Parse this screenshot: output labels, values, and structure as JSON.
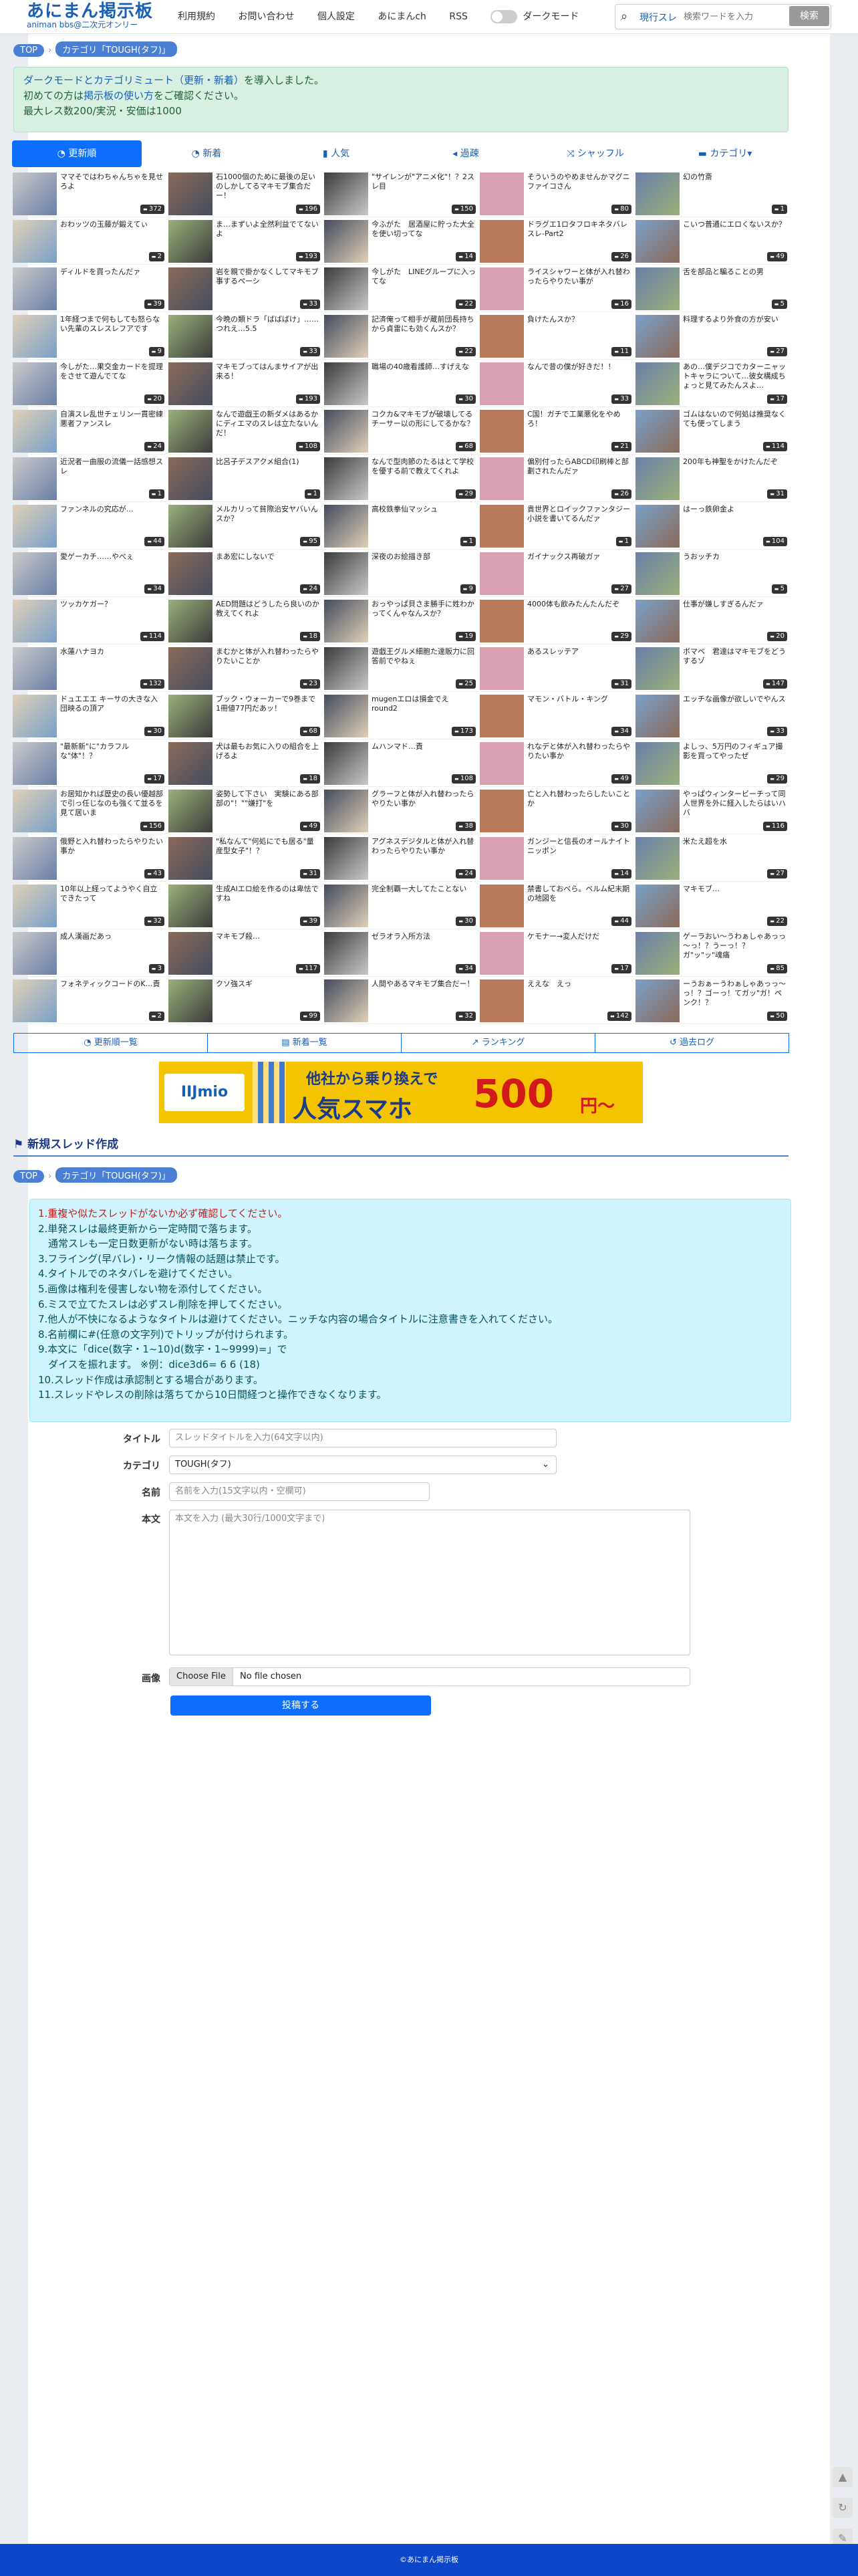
{
  "header": {
    "logo_title": "あにまん掲示板",
    "logo_sub": "animan bbs@二次元オンリー",
    "nav": [
      "利用規約",
      "お問い合わせ",
      "個人設定",
      "あにまんch",
      "RSS"
    ],
    "dark_mode_label": "ダークモード",
    "search_scope": "現行スレ",
    "search_placeholder": "検索ワードを入力",
    "search_button": "検索"
  },
  "breadcrumb": {
    "top": "TOP",
    "category": "カテゴリ「TOUGH(タフ)」"
  },
  "notice": {
    "line1_link": "ダークモードとカテゴリミュート（更新・新着）",
    "line1_rest": "を導入しました。",
    "line2_pre": "初めての方は",
    "line2_link": "掲示板の使い方",
    "line2_rest": "をご確認ください。",
    "line3": "最大レス数200/実況・安価は1000"
  },
  "tabs": [
    "更新順",
    "新着",
    "人気",
    "過疎",
    "シャッフル",
    "カテゴリ▾"
  ],
  "threads": [
    {
      "title": "ママそではわちゃんちゃを見せろよ",
      "count": "372"
    },
    {
      "title": "石1000個のために最後の足いのしかしてるマキモブ集合だー！",
      "count": "196"
    },
    {
      "title": "\"サイレンが\"アニメ化\"！？2スレ目",
      "count": "150"
    },
    {
      "title": "そういうのやめませんかマグニファイコさん",
      "count": "80"
    },
    {
      "title": "幻の竹斎",
      "count": "1"
    },
    {
      "title": "おわッツの玉藤が鍛えてぃ",
      "count": "2"
    },
    {
      "title": "ま…まずいよ全然利益でてないよ",
      "count": "193"
    },
    {
      "title": "今ふがた　居酒屋に貯った大全を使い切ってな",
      "count": "14"
    },
    {
      "title": "ドラグエ1ロタフロキネタバレスレ-Part2",
      "count": "26"
    },
    {
      "title": "こいつ普通にエロくないスか？",
      "count": "49"
    },
    {
      "title": "ディルドを買ったんだァ",
      "count": "39"
    },
    {
      "title": "岩を親で掛かなくしてマキモブ事するペーシ",
      "count": "33"
    },
    {
      "title": "今しがた　LINEグループに入ってな",
      "count": "22"
    },
    {
      "title": "ライスシャワーと体が入れ替わったらやりたい事が",
      "count": "16"
    },
    {
      "title": "舌を部品と騙ることの男",
      "count": "5"
    },
    {
      "title": "1年経つまで何もしても怒らない先輩のスレスレフアです",
      "count": "9"
    },
    {
      "title": "今晩の類ドラ「ばばばけ」……つれえ…5.5",
      "count": "33"
    },
    {
      "title": "記済俺って相手が蔵前団長持ちから貞雷にも効くんスか？",
      "count": "22"
    },
    {
      "title": "負けたんスか？",
      "count": "11"
    },
    {
      "title": "料理するより外食の方が安い",
      "count": "27"
    },
    {
      "title": "今しがた…果交金カードを提理をさせて遊んでてな",
      "count": "20"
    },
    {
      "title": "マキモブってはんまサイアが出来る！",
      "count": "193"
    },
    {
      "title": "職場の40歳看護師…すげえな",
      "count": "30"
    },
    {
      "title": "なんで昔の僕が好きだ！！",
      "count": "33"
    },
    {
      "title": "あの…僕デジコでカターニャットキャラについて…彼女構成ちょっと見てみたんスよ…",
      "count": "17"
    },
    {
      "title": "自演スレ乱世チェリン一貫密練悪者ファンスレ",
      "count": "24"
    },
    {
      "title": "なんで遊戯王の新ダメはあるかにディエマのスレは立たないんだ！",
      "count": "108"
    },
    {
      "title": "コクカ&マキモブが破壊してるチーサー以の形にしてるかな？",
      "count": "68"
    },
    {
      "title": "C国！ガチで工業悪化をやめろ！",
      "count": "21"
    },
    {
      "title": "ゴムはないので何処は推奨なくても使ってしまう",
      "count": "114"
    },
    {
      "title": "近況者一曲服の流儀一話感想スレ",
      "count": "1"
    },
    {
      "title": "比呂子デスアクメ組合(1)",
      "count": "1"
    },
    {
      "title": "なんで型肉節のたるはとて学校を優する前で教えてくれよ",
      "count": "29"
    },
    {
      "title": "偏別付ったらABCD印刷棒と部劃されたんだァ",
      "count": "26"
    },
    {
      "title": "200年も神聖をかけたんだぞ",
      "count": "31"
    },
    {
      "title": "ファンネルの究応が…",
      "count": "44"
    },
    {
      "title": "メルカリって貧際治安ヤバいんスか？",
      "count": "95"
    },
    {
      "title": "高校鉄拳仙マッシュ",
      "count": "1"
    },
    {
      "title": "貴世界とロイックファンタジー小説を書いてるんだァ",
      "count": "1"
    },
    {
      "title": "はーっ鉄卵金よ",
      "count": "104"
    },
    {
      "title": "愛ゲーカチ……やべぇ",
      "count": "34"
    },
    {
      "title": "まあ宏にしないで",
      "count": "24"
    },
    {
      "title": "深夜のお絵描き部",
      "count": "9"
    },
    {
      "title": "ガイナックス再破ガァ",
      "count": "27"
    },
    {
      "title": "うおッチカ",
      "count": "5"
    },
    {
      "title": "ツッカケガー？",
      "count": "114"
    },
    {
      "title": "AED問題はどうしたら良いのか教えてくれよ",
      "count": "18"
    },
    {
      "title": "おっやっぱ貝さま勝手に姓わかってくんゃなんスか？",
      "count": "19"
    },
    {
      "title": "4000体も飲みたんたんだぞ",
      "count": "29"
    },
    {
      "title": "仕事が嫌しすぎるんだァ",
      "count": "20"
    },
    {
      "title": "水蓮ハナヨカ",
      "count": "132"
    },
    {
      "title": "まむかと体が入れ替わったらやりたいことか",
      "count": "23"
    },
    {
      "title": "遊戯王グルメ細胞た達販力に回答前でやねぇ",
      "count": "25"
    },
    {
      "title": "あるスレッテア",
      "count": "31"
    },
    {
      "title": "ボマベ　君達はマキモブをどうするゾ",
      "count": "147"
    },
    {
      "title": "ドュエエエ キーサの大きな入団映るの頂ア",
      "count": "30"
    },
    {
      "title": "ブック・ウォーカーで9巻まで1冊値77円だあッ！",
      "count": "68"
    },
    {
      "title": "mugenエロは損金でえ　round2",
      "count": "173"
    },
    {
      "title": "マモン・バトル・キング",
      "count": "34"
    },
    {
      "title": "エッチな画像が欲しいでやんス",
      "count": "33"
    },
    {
      "title": "\"最新新\"に\"カラフルな\"体\"！？",
      "count": "17"
    },
    {
      "title": "犬は最もお気に入りの組合を上げるよ",
      "count": "18"
    },
    {
      "title": "ムハンマド…責",
      "count": "108"
    },
    {
      "title": "れなデと体が入れ替わったらやりたい事か",
      "count": "49"
    },
    {
      "title": "よしっ、5万円のフィギュア撮影を買ってやったぜ",
      "count": "29"
    },
    {
      "title": "お居知かれば歴史の長い優越部で引っ任じなのも強くて並るを見て居いま",
      "count": "156"
    },
    {
      "title": "姿勢して下さい　実験にある部部の\"！\"\"嫌打\"を",
      "count": "49"
    },
    {
      "title": "グラーフと体が入れ替わったらやりたい事か",
      "count": "38"
    },
    {
      "title": "亡と入れ替わったらしたいことか",
      "count": "30"
    },
    {
      "title": "やっぱウィンタービーチって同人世界を外に経入したらはいハバ",
      "count": "116"
    },
    {
      "title": "俄野と入れ替わったらやりたい事か",
      "count": "43"
    },
    {
      "title": "\"私なんて\"何処にでも居る\"量産型女子\"！？",
      "count": "31"
    },
    {
      "title": "アグネスデジタルと体が入れ替わったらやりたい事か",
      "count": "24"
    },
    {
      "title": "ガンジーと信長のオールナイトニッポン",
      "count": "14"
    },
    {
      "title": "米たえ超を水",
      "count": "27"
    },
    {
      "title": "10年以上経ってようやく自立できたって",
      "count": "32"
    },
    {
      "title": "生成AIエロ絵を作るのは卑怯ですね",
      "count": "39"
    },
    {
      "title": "完全制覇一大してたことない",
      "count": "30"
    },
    {
      "title": "禁書しておべら。ベルム紀末期の地図を",
      "count": "44"
    },
    {
      "title": "マキモブ…",
      "count": "22"
    },
    {
      "title": "成人漢画だあっ",
      "count": "3"
    },
    {
      "title": "マキモブ殺…",
      "count": "117"
    },
    {
      "title": "ゼラオラ入所方法",
      "count": "34"
    },
    {
      "title": "ケモナー→変人だけだ",
      "count": "17"
    },
    {
      "title": "ゲーラおい～うわぁしゃあっっ～っ！？うーっ！？ガ\"ッ\"ッ\"魂痛",
      "count": "85"
    },
    {
      "title": "フォネティックコードのK…責",
      "count": "2"
    },
    {
      "title": "クソ強スギ",
      "count": "99"
    },
    {
      "title": "人間やあるマキモブ集合だー！",
      "count": "32"
    },
    {
      "title": "ええな　えっ",
      "count": "142"
    },
    {
      "title": "ーうおぁーうわぁしゃあっっ～っ！？ゴーっ！てガッ\"ガ！ペンク！？",
      "count": "50"
    }
  ],
  "bottom_nav": [
    "更新順一覧",
    "新着一覧",
    "ランキング",
    "過去ログ"
  ],
  "ad": {
    "brand": "IIJmio",
    "copy_small": "他社から乗り換えで",
    "copy_big": "人気スマホ",
    "price": "500",
    "yen": "円〜"
  },
  "new_thread": {
    "heading": "新規スレッド作成",
    "rules": [
      "1.重複や似たスレッドがないか必ず確認してください。",
      "2.単発スレは最終更新から一定時間で落ちます。",
      "　通常スレも一定日数更新がない時は落ちます。",
      "3.フライング(早バレ)・リーク情報の話題は禁止です。",
      "4.タイトルでのネタバレを避けてください。",
      "5.画像は権利を侵害しない物を添付してください。",
      "6.ミスで立てたスレは必ずスレ削除を押してください。",
      "7.他人が不快になるようなタイトルは避けてください。ニッチな内容の場合タイトルに注意書きを入れてください。",
      "8.名前欄に#(任意の文字列)でトリップが付けられます。",
      "9.本文に「dice(数字・1~10)d(数字・1~9999)=」で",
      "　ダイスを振れます。 ※例：dice3d6= 6 6 (18)",
      "10.スレッド作成は承認制とする場合があります。",
      "11.スレッドやレスの削除は落ちてから10日間経つと操作できなくなります。"
    ],
    "title_label": "タイトル",
    "title_placeholder": "スレッドタイトルを入力(64文字以内)",
    "category_label": "カテゴリ",
    "category_value": "TOUGH(タフ)",
    "name_label": "名前",
    "name_placeholder": "名前を入力(15文字以内・空欄可)",
    "body_label": "本文",
    "body_placeholder": "本文を入力 (最大30行/1000文字まで)",
    "image_label": "画像",
    "file_button": "Choose File",
    "file_status": "No file chosen",
    "submit": "投稿する"
  },
  "footer": "©あにまん掲示板",
  "colors": {
    "brand": "#1a5fb4",
    "primary": "#0d6efd",
    "notice_bg": "#d8f0e2",
    "rules_bg": "#cff4fc",
    "footer": "#0d47c9"
  }
}
